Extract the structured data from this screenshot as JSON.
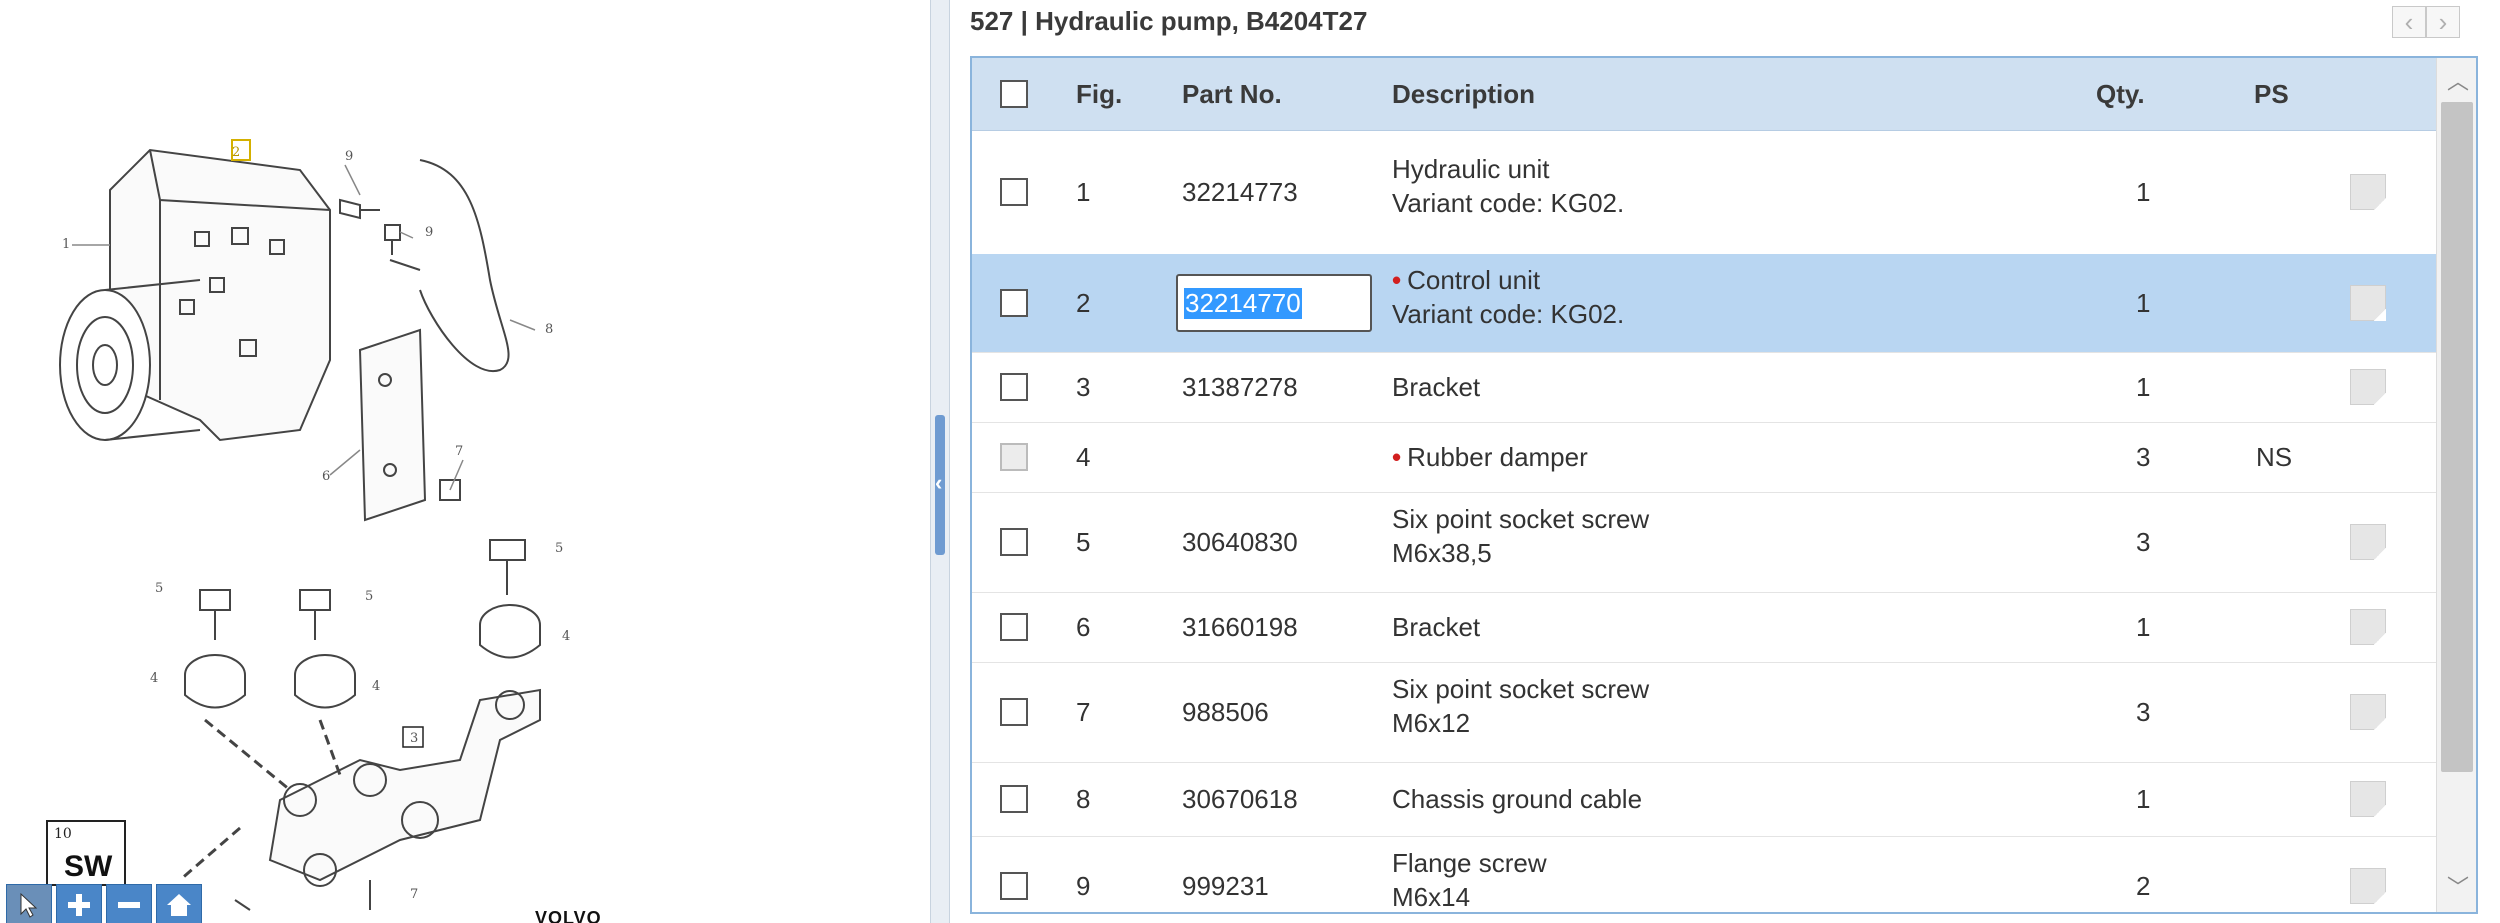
{
  "header": {
    "title": "527  |  Hydraulic pump, B4204T27",
    "prev_arrow": "‹",
    "next_arrow": "›"
  },
  "table": {
    "columns": [
      "Fig.",
      "Part No.",
      "Description",
      "Qty.",
      "PS"
    ],
    "rows": [
      {
        "fig": "1",
        "part_no": "32214773",
        "description": "Hydraulic unit",
        "variant": "Variant code: KG02.",
        "qty": "1",
        "ps": "",
        "marked": false,
        "selected": false,
        "has_note": true
      },
      {
        "fig": "2",
        "part_no": "32214770",
        "description": "Control unit",
        "variant": "Variant code: KG02.",
        "qty": "1",
        "ps": "",
        "marked": true,
        "selected": true,
        "has_note": true
      },
      {
        "fig": "3",
        "part_no": "31387278",
        "description": "Bracket",
        "variant": "",
        "qty": "1",
        "ps": "",
        "marked": false,
        "selected": false,
        "has_note": true
      },
      {
        "fig": "4",
        "part_no": "",
        "description": "Rubber damper",
        "variant": "",
        "qty": "3",
        "ps": "NS",
        "marked": true,
        "selected": false,
        "has_note": false
      },
      {
        "fig": "5",
        "part_no": "30640830",
        "description": "Six point socket screw",
        "variant": "M6x38,5",
        "qty": "3",
        "ps": "",
        "marked": false,
        "selected": false,
        "has_note": true
      },
      {
        "fig": "6",
        "part_no": "31660198",
        "description": "Bracket",
        "variant": "",
        "qty": "1",
        "ps": "",
        "marked": false,
        "selected": false,
        "has_note": true
      },
      {
        "fig": "7",
        "part_no": "988506",
        "description": "Six point socket screw",
        "variant": "M6x12",
        "qty": "3",
        "ps": "",
        "marked": false,
        "selected": false,
        "has_note": true
      },
      {
        "fig": "8",
        "part_no": "30670618",
        "description": "Chassis ground cable",
        "variant": "",
        "qty": "1",
        "ps": "",
        "marked": false,
        "selected": false,
        "has_note": true
      },
      {
        "fig": "9",
        "part_no": "999231",
        "description": "Flange screw",
        "variant": "M6x14",
        "qty": "2",
        "ps": "",
        "marked": false,
        "selected": false,
        "has_note": true
      }
    ]
  },
  "diagram": {
    "callouts": [
      "2",
      "9",
      "1",
      "9",
      "8",
      "6",
      "7",
      "5",
      "5",
      "5",
      "4",
      "4",
      "4",
      "3",
      "7"
    ],
    "sw_number": "10",
    "sw_label": "SW",
    "brand": "VOLVO"
  },
  "toolbar": {
    "tools": [
      "pointer-icon",
      "zoom-in-icon",
      "zoom-out-icon",
      "home-icon"
    ]
  }
}
